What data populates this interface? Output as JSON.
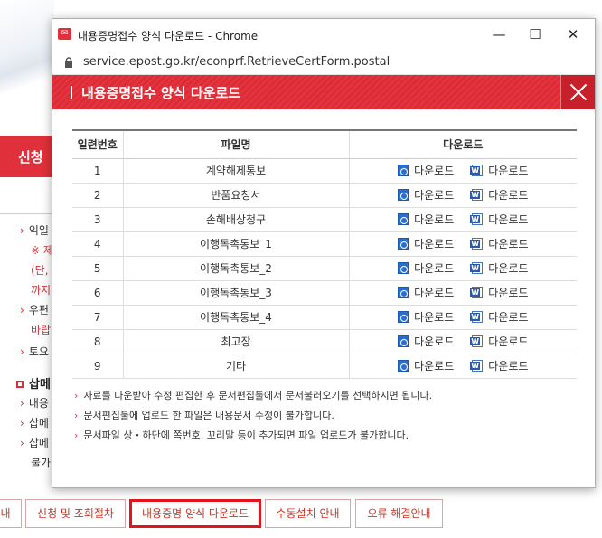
{
  "background": {
    "red_label": "신청",
    "items": [
      {
        "text": "익일",
        "red": false,
        "arrow": true
      },
      {
        "text": "※ 제",
        "red": true,
        "arrow": false
      },
      {
        "text": "(단,",
        "red": true,
        "arrow": false
      },
      {
        "text": "까지",
        "red": true,
        "arrow": false
      },
      {
        "text": "우편",
        "red": false,
        "arrow": true
      },
      {
        "text": "바랍",
        "red": true,
        "arrow": false
      },
      {
        "text": "토요",
        "red": false,
        "arrow": true
      },
      {
        "text": "내용",
        "red": false,
        "arrow": true
      },
      {
        "text": "삽메",
        "red": false,
        "arrow": true
      },
      {
        "text": "삽메",
        "red": false,
        "arrow": true
      },
      {
        "text": "불가",
        "red": false,
        "arrow": false
      }
    ],
    "section_heading": "삽메",
    "tabs": [
      "내",
      "신청 및 조회절차",
      "내용증명 양식 다운로드",
      "수동설치 안내",
      "오류 해결안내"
    ]
  },
  "window": {
    "title": "내용증명접수 양식 다운로드 - Chrome",
    "app_icon_text": "✉",
    "controls": {
      "minimize": "—",
      "maximize": "☐",
      "close": "✕"
    },
    "url": "service.epost.go.kr/econprf.RetrieveCertForm.postal"
  },
  "popup": {
    "title": "내용증명접수 양식 다운로드",
    "table": {
      "headers": [
        "일련번호",
        "파일명",
        "다운로드"
      ],
      "download_label": "다운로드",
      "rows": [
        {
          "no": "1",
          "name": "계약해제통보"
        },
        {
          "no": "2",
          "name": "반품요청서"
        },
        {
          "no": "3",
          "name": "손해배상청구"
        },
        {
          "no": "4",
          "name": "이행독촉통보_1"
        },
        {
          "no": "5",
          "name": "이행독촉통보_2"
        },
        {
          "no": "6",
          "name": "이행독촉통보_3"
        },
        {
          "no": "7",
          "name": "이행독촉통보_4"
        },
        {
          "no": "8",
          "name": "최고장"
        },
        {
          "no": "9",
          "name": "기타"
        }
      ]
    },
    "notes": [
      "자료를 다운받아 수정 편집한 후 문서편집툴에서 문서불러오기를 선택하시면 됩니다.",
      "문서편집툴에 업로드 한 파일은 내용문서 수정이 불가합니다.",
      "문서파일 상・하단에 쪽번호, 꼬리말 등이 추가되면 파일 업로드가 불가합니다."
    ],
    "note_arrow": "›"
  },
  "icons": {
    "hwp": "hwp-file-icon",
    "doc": "word-file-icon"
  },
  "colors": {
    "accent": "#e3343e",
    "active_tab_border": "#e3141d"
  }
}
